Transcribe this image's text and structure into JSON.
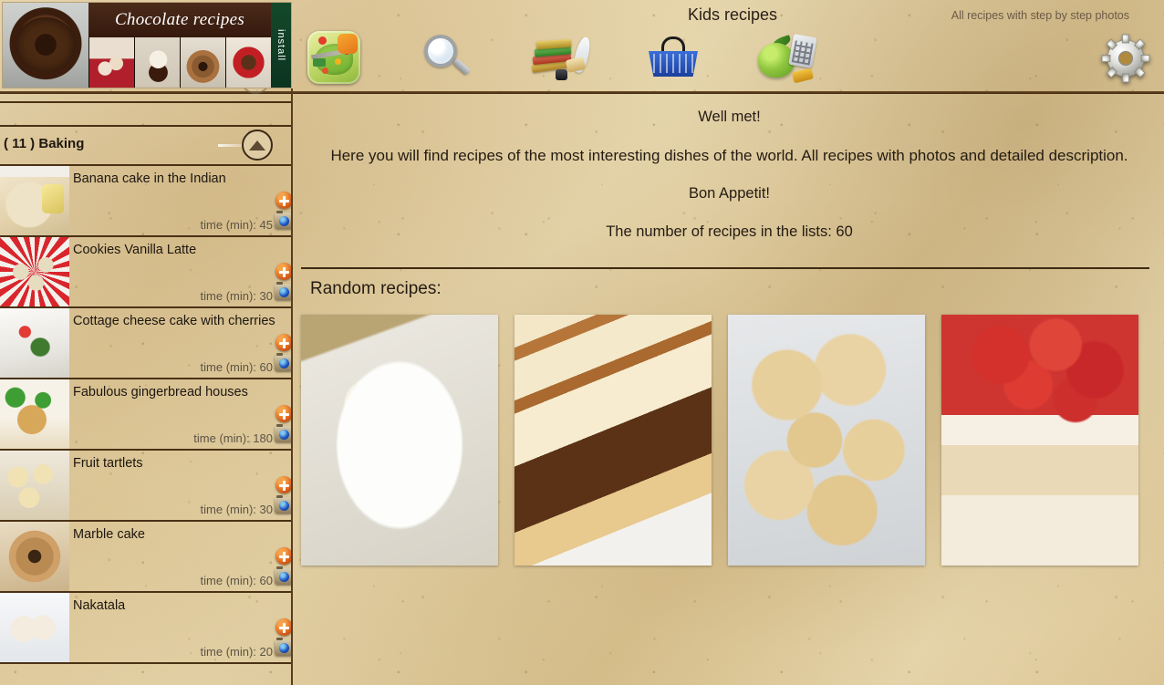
{
  "ad": {
    "title": "Chocolate recipes",
    "install_label": "install"
  },
  "header": {
    "app_title": "Kids recipes",
    "tagline": "All recipes with step by step photos",
    "toolbar": [
      {
        "name": "home-icon",
        "label": "Home"
      },
      {
        "name": "search-icon",
        "label": "Search"
      },
      {
        "name": "recipe-books-icon",
        "label": "Recipe books"
      },
      {
        "name": "shopping-basket-icon",
        "label": "Shopping basket"
      },
      {
        "name": "calories-calculator-icon",
        "label": "Calories calculator"
      }
    ],
    "settings_label": "Settings"
  },
  "sidebar": {
    "category": {
      "count": "( 11 )",
      "name": "Baking"
    },
    "time_prefix": "time (min): ",
    "items": [
      {
        "title": "Banana cake in the Indian",
        "time": "time (min): 45",
        "thumb_class": "th-banana"
      },
      {
        "title": "Cookies Vanilla Latte",
        "time": "time (min): 30",
        "thumb_class": "th-cookies"
      },
      {
        "title": "Cottage cheese cake with cherries",
        "time": "time (min): 60",
        "thumb_class": "th-cottage"
      },
      {
        "title": "Fabulous gingerbread houses",
        "time": "time (min): 180",
        "thumb_class": "th-ginger"
      },
      {
        "title": "Fruit tartlets",
        "time": "time (min): 30",
        "thumb_class": "th-tartlets"
      },
      {
        "title": "Marble cake",
        "time": "time (min): 60",
        "thumb_class": "th-marble"
      },
      {
        "title": "Nakatala",
        "time": "time (min): 20",
        "thumb_class": "th-nakatala"
      }
    ]
  },
  "main": {
    "greeting": "Well met!",
    "intro": "Here you will find recipes of the most interesting dishes of the world. All recipes with photos and detailed description.",
    "bon_appetit": "Bon Appetit!",
    "recipe_count": "The number of recipes in the lists: 60",
    "random_heading": "Random recipes:",
    "random_recipes": [
      {
        "alt": "Bread slices with cream and pistachios on a white plate",
        "class": "rnd-1"
      },
      {
        "alt": "Slices of marble layer cake with chocolate",
        "class": "rnd-2"
      },
      {
        "alt": "Sugared doughnut holes in a white bowl",
        "class": "rnd-3"
      },
      {
        "alt": "Layer cake topped with strawberries and pistachios",
        "class": "rnd-4"
      }
    ]
  },
  "colors": {
    "parchment": "#e2cda0",
    "rule": "#3f2a12",
    "text": "#241c12",
    "muted_text": "#5d5445",
    "badge_plus": "#d9601b",
    "badge_camera_lens": "#1f58c4",
    "ad_title_bar": "#3a1d0e",
    "install_strip": "#0f4026"
  }
}
